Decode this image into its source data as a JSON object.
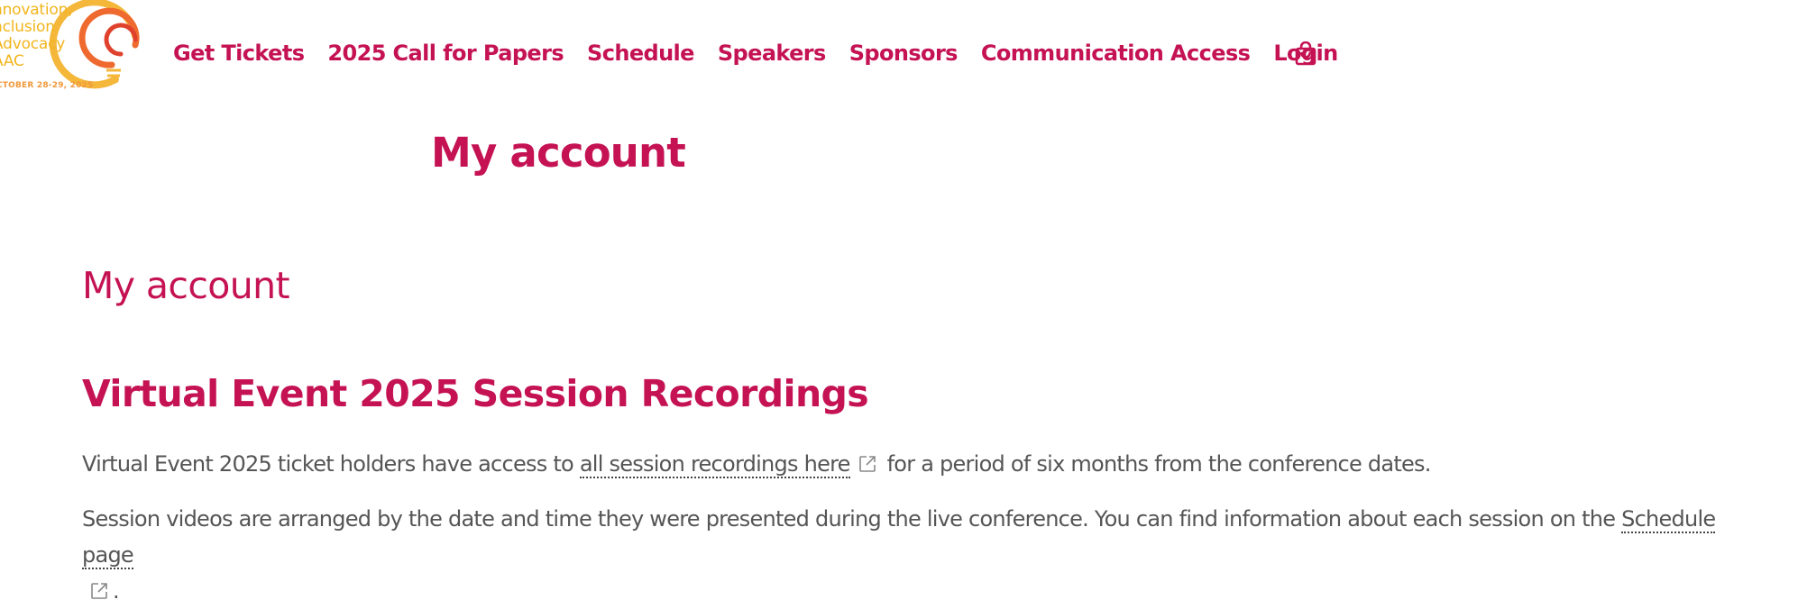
{
  "logo": {
    "lines": [
      "nnovation,",
      "nclusion",
      "Advocacy",
      "AAC"
    ],
    "date": "CTOBER 28-29, 2025",
    "colors": {
      "text": "#f2b51d",
      "arc_outer": "#f4b73a",
      "arc_inner": "#e0412d"
    }
  },
  "nav": {
    "items": [
      "Get Tickets",
      "2025 Call for Papers",
      "Schedule",
      "Speakers",
      "Sponsors",
      "Communication Access",
      "Login"
    ],
    "cart_icon": "shopping-bag-icon"
  },
  "page_title": "My account",
  "subtitle": "My account",
  "section": {
    "title": "Virtual Event 2025 Session Recordings",
    "para1": {
      "before": "Virtual Event 2025 ticket holders have access to ",
      "link": "all session recordings here",
      "after": " for a period of six months from the conference dates."
    },
    "para2": {
      "before": "Session videos are arranged by the date and time they were presented during the live conference. You can find information about each session on the ",
      "link": "Schedule page",
      "after": "."
    },
    "external_icon": "external-link-icon"
  },
  "colors": {
    "accent": "#c41253",
    "body_text": "#555555"
  }
}
